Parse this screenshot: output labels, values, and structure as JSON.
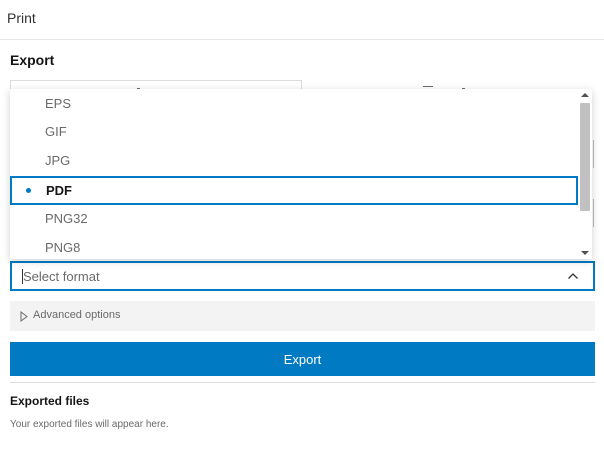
{
  "panel": {
    "title": "Print"
  },
  "section": {
    "heading": "Export"
  },
  "format_dropdown": {
    "options": [
      "EPS",
      "GIF",
      "JPG",
      "PDF",
      "PNG32",
      "PNG8"
    ],
    "selected": "PDF",
    "placeholder": "Select format"
  },
  "advanced": {
    "label": "Advanced options"
  },
  "export_button": {
    "label": "Export"
  },
  "exported_files": {
    "heading": "Exported files",
    "empty_message": "Your exported files will appear here."
  },
  "colors": {
    "accent": "#007ac2",
    "advanced_bg": "#f3f3f3",
    "scroll_thumb": "#c1c1c1"
  },
  "icons": {
    "format_chevron": "chevron-up-icon",
    "advanced_chevron": "chevron-right-outline-icon",
    "selected_marker": "dot-icon"
  }
}
